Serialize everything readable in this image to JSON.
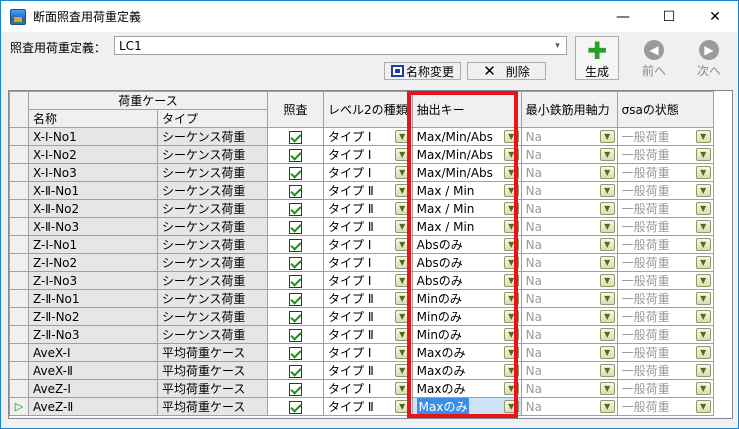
{
  "window": {
    "title": "断面照査用荷重定義",
    "controls": [
      "—",
      "☐",
      "✕"
    ]
  },
  "toolbar": {
    "definition_label": "照査用荷重定義：",
    "definition_value": "LC1",
    "rename_label": "名称変更",
    "delete_label": "削除",
    "generate_label": "生成",
    "prev_label": "前へ",
    "next_label": "次へ"
  },
  "grid": {
    "group_header": "荷重ケース",
    "headers": {
      "name": "名称",
      "type": "タイプ",
      "check": "照査",
      "level2": "レベル2の種類",
      "extract_key": "抽出キー",
      "min_axial": "最小鉄筋用軸力",
      "sigma_sa": "σsaの状態"
    },
    "rows": [
      {
        "name": "X-I-No1",
        "type": "シーケンス荷重",
        "checked": true,
        "level2": "タイプ I",
        "key": "Max/Min/Abs",
        "min_axial": "Na",
        "sigma": "一般荷重"
      },
      {
        "name": "X-I-No2",
        "type": "シーケンス荷重",
        "checked": true,
        "level2": "タイプ I",
        "key": "Max/Min/Abs",
        "min_axial": "Na",
        "sigma": "一般荷重"
      },
      {
        "name": "X-I-No3",
        "type": "シーケンス荷重",
        "checked": true,
        "level2": "タイプ I",
        "key": "Max/Min/Abs",
        "min_axial": "Na",
        "sigma": "一般荷重"
      },
      {
        "name": "X-Ⅱ-No1",
        "type": "シーケンス荷重",
        "checked": true,
        "level2": "タイプ Ⅱ",
        "key": "Max / Min",
        "min_axial": "Na",
        "sigma": "一般荷重"
      },
      {
        "name": "X-Ⅱ-No2",
        "type": "シーケンス荷重",
        "checked": true,
        "level2": "タイプ Ⅱ",
        "key": "Max / Min",
        "min_axial": "Na",
        "sigma": "一般荷重"
      },
      {
        "name": "X-Ⅱ-No3",
        "type": "シーケンス荷重",
        "checked": true,
        "level2": "タイプ Ⅱ",
        "key": "Max / Min",
        "min_axial": "Na",
        "sigma": "一般荷重"
      },
      {
        "name": "Z-I-No1",
        "type": "シーケンス荷重",
        "checked": true,
        "level2": "タイプ I",
        "key": "Absのみ",
        "min_axial": "Na",
        "sigma": "一般荷重"
      },
      {
        "name": "Z-I-No2",
        "type": "シーケンス荷重",
        "checked": true,
        "level2": "タイプ I",
        "key": "Absのみ",
        "min_axial": "Na",
        "sigma": "一般荷重"
      },
      {
        "name": "Z-I-No3",
        "type": "シーケンス荷重",
        "checked": true,
        "level2": "タイプ I",
        "key": "Absのみ",
        "min_axial": "Na",
        "sigma": "一般荷重"
      },
      {
        "name": "Z-Ⅱ-No1",
        "type": "シーケンス荷重",
        "checked": true,
        "level2": "タイプ Ⅱ",
        "key": "Minのみ",
        "min_axial": "Na",
        "sigma": "一般荷重"
      },
      {
        "name": "Z-Ⅱ-No2",
        "type": "シーケンス荷重",
        "checked": true,
        "level2": "タイプ Ⅱ",
        "key": "Minのみ",
        "min_axial": "Na",
        "sigma": "一般荷重"
      },
      {
        "name": "Z-Ⅱ-No3",
        "type": "シーケンス荷重",
        "checked": true,
        "level2": "タイプ Ⅱ",
        "key": "Minのみ",
        "min_axial": "Na",
        "sigma": "一般荷重"
      },
      {
        "name": "AveX-I",
        "type": "平均荷重ケース",
        "checked": true,
        "level2": "タイプ I",
        "key": "Maxのみ",
        "min_axial": "Na",
        "sigma": "一般荷重"
      },
      {
        "name": "AveX-Ⅱ",
        "type": "平均荷重ケース",
        "checked": true,
        "level2": "タイプ Ⅱ",
        "key": "Maxのみ",
        "min_axial": "Na",
        "sigma": "一般荷重"
      },
      {
        "name": "AveZ-I",
        "type": "平均荷重ケース",
        "checked": true,
        "level2": "タイプ I",
        "key": "Maxのみ",
        "min_axial": "Na",
        "sigma": "一般荷重"
      },
      {
        "name": "AveZ-Ⅱ",
        "type": "平均荷重ケース",
        "checked": true,
        "level2": "タイプ Ⅱ",
        "key": "Maxのみ",
        "min_axial": "Na",
        "sigma": "一般荷重",
        "selected": true
      }
    ],
    "current_row_marker": "▷"
  },
  "icons": {
    "app": "app-icon",
    "rename": "rename-icon",
    "delete": "delete-icon",
    "generate": "plus-icon",
    "prev": "arrow-left-icon",
    "next": "arrow-right-icon",
    "dropdown": "chevron-down-icon",
    "plus_glyph": "✚",
    "prev_glyph": "◀",
    "next_glyph": "▶",
    "delete_glyph": "✕",
    "combo_arrow": "▾",
    "dd_arrow": "▼"
  },
  "colors": {
    "highlight_border": "#e8141c",
    "selection": "#3a8ee6",
    "generate_icon": "#2aa02a"
  }
}
